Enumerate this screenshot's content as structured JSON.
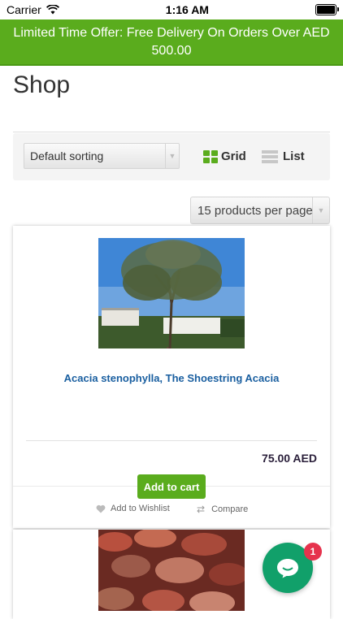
{
  "status_bar": {
    "carrier": "Carrier",
    "time": "1:16 AM"
  },
  "promo": {
    "text": "Limited Time Offer: Free Delivery On Orders Over AED 500.00"
  },
  "page": {
    "title": "Shop"
  },
  "toolbar": {
    "sort_value": "Default sorting",
    "grid_label": "Grid",
    "list_label": "List",
    "per_page_value": "15 products per page"
  },
  "products": [
    {
      "name": "Acacia stenophylla, The Shoestring Acacia",
      "price": "75.00 AED",
      "add_to_cart": "Add to cart",
      "wishlist_label": "Add to Wishlist",
      "compare_label": "Compare"
    }
  ],
  "chat": {
    "badge_count": "1"
  },
  "colors": {
    "accent": "#5aac1d",
    "link": "#1a5fa0",
    "chat": "#11a06a",
    "badge": "#e6334d"
  }
}
